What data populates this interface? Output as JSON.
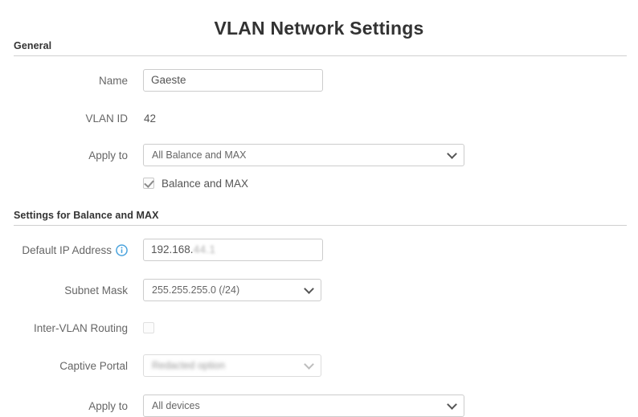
{
  "page": {
    "title": "VLAN Network Settings"
  },
  "sections": [
    {
      "id": "general",
      "header": "General"
    },
    {
      "id": "settings_balance_max",
      "header": "Settings for Balance and MAX"
    }
  ],
  "general": {
    "name": {
      "label": "Name",
      "value": "Gaeste",
      "placeholder": ""
    },
    "vlan_id": {
      "label": "VLAN ID",
      "value": "42"
    },
    "apply_to": {
      "label": "Apply to",
      "selected": "All Balance and MAX",
      "options": [
        "All Balance and MAX"
      ]
    },
    "device_checkbox": {
      "label": "Balance and MAX",
      "checked": true
    }
  },
  "balance_max": {
    "default_ip": {
      "label": "Default IP Address",
      "info_icon": "info-circle-icon",
      "value_visible": "192.168.",
      "value_redacted": "44.1"
    },
    "subnet_mask": {
      "label": "Subnet Mask",
      "selected": "255.255.255.0 (/24)",
      "options": [
        "255.255.255.0 (/24)"
      ]
    },
    "inter_vlan_routing": {
      "label": "Inter-VLAN Routing",
      "checked": false
    },
    "captive_portal": {
      "label": "Captive Portal",
      "selected": "Redacted option",
      "disabled": true
    },
    "apply_to": {
      "label": "Apply to",
      "selected": "All devices",
      "options": [
        "All devices"
      ]
    }
  },
  "colors": {
    "info_icon": "#4aa3dd",
    "rule": "#cfcfcf",
    "text": "#555555",
    "label": "#666666",
    "heading": "#333333",
    "border": "#cccccc"
  }
}
